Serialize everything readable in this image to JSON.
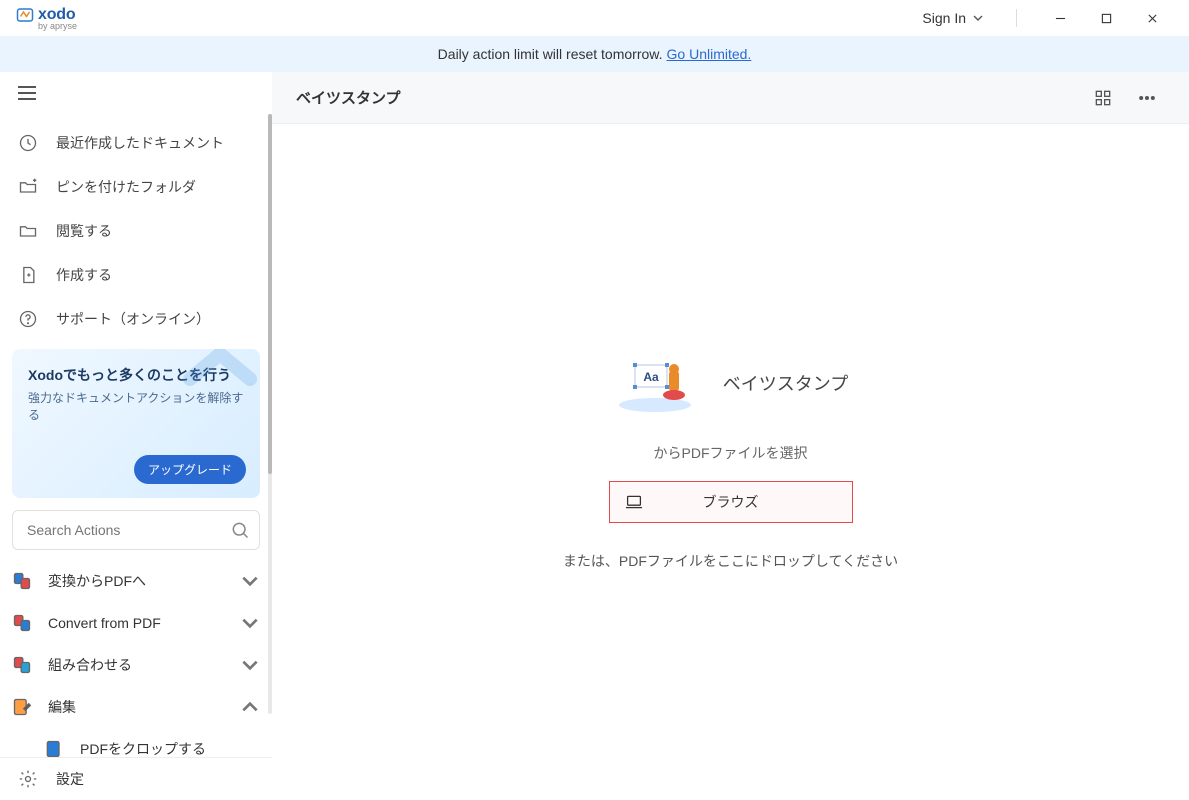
{
  "app": {
    "logo_text": "xodo",
    "logo_subtitle": "by apryse",
    "sign_in": "Sign In"
  },
  "banner": {
    "text": "Daily action limit will reset tomorrow. ",
    "link": "Go Unlimited."
  },
  "sidebar": {
    "nav": {
      "recent": "最近作成したドキュメント",
      "pinned": "ピンを付けたフォルダ",
      "browse": "閲覧する",
      "create": "作成する",
      "support": "サポート（オンライン）"
    },
    "promo": {
      "title": "Xodoでもっと多くのことを行う",
      "subtitle": "強力なドキュメントアクションを解除する",
      "button": "アップグレード"
    },
    "search": {
      "placeholder": "Search Actions"
    },
    "categories": {
      "to_pdf": "変換からPDFへ",
      "from_pdf": "Convert from PDF",
      "combine": "組み合わせる",
      "edit": "編集",
      "crop_pdf": "PDFをクロップする"
    },
    "settings": "設定"
  },
  "main": {
    "page_title": "ベイツスタンプ",
    "hero_title": "ベイツスタンプ",
    "instruction": "からPDFファイルを選択",
    "browse_btn": "ブラウズ",
    "drop_hint": "または、PDFファイルをここにドロップしてください"
  }
}
